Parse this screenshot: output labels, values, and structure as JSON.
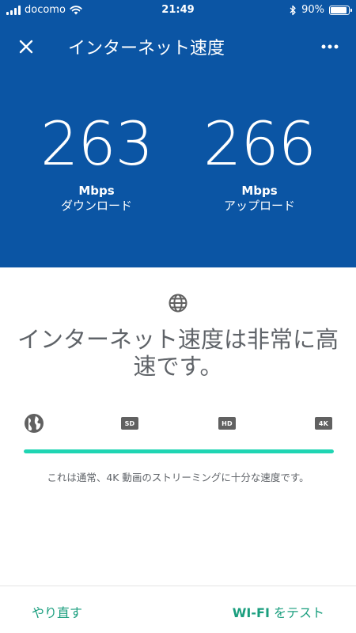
{
  "status_bar": {
    "carrier": "docomo",
    "time": "21:49",
    "battery": "90%",
    "battery_level": 0.9
  },
  "header": {
    "title": "インターネット速度"
  },
  "results": {
    "download": {
      "value": "263",
      "unit": "Mbps",
      "label": "ダウンロード"
    },
    "upload": {
      "value": "266",
      "unit": "Mbps",
      "label": "アップロード"
    }
  },
  "summary": {
    "headline": "インターネット速度は非常に高速です。",
    "description": "これは通常、4K 動画のストリーミングに十分な速度です。"
  },
  "quality_scale": {
    "icons": [
      "globe-icon",
      "sd-icon",
      "hd-icon",
      "4k-icon"
    ],
    "sd_label": "SD",
    "hd_label": "HD",
    "uhd_label": "4K",
    "level": 1.0,
    "accent_color": "#1fd5b3"
  },
  "footer": {
    "retry_label": "やり直す",
    "wifi_label_strong": "WI-FI",
    "wifi_label_rest": " をテスト"
  },
  "colors": {
    "header_bg": "#0b55a4",
    "action": "#1a9e7e"
  }
}
